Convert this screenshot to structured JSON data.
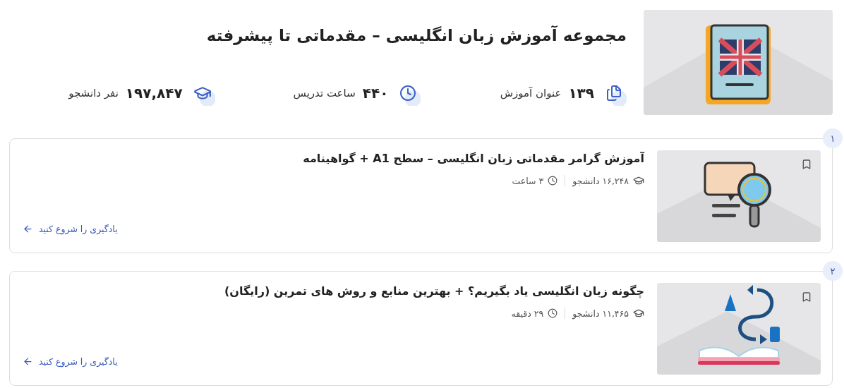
{
  "course": {
    "title": "مجموعه آموزش زبان انگلیسی – مقدماتی تا پیشرفته",
    "stats": [
      {
        "kind": "lessons",
        "value": "۱۳۹",
        "label": "عنوان آموزش"
      },
      {
        "kind": "hours",
        "value": "۴۴۰",
        "label": "ساعت تدریس"
      },
      {
        "kind": "students",
        "value": "۱۹۷,۸۴۷",
        "label": "نفر دانشجو"
      }
    ]
  },
  "lessons": [
    {
      "number": "۱",
      "title": "آموزش گرامر مقدماتی زبان انگلیسی – سطح A1 + گواهینامه",
      "students": "۱۶,۲۴۸ دانشجو",
      "duration": "۳ ساعت",
      "link": "یادگیری را شروع کنید"
    },
    {
      "number": "۲",
      "title": "چگونه زبان انگلیسی یاد بگیریم؟ + بهترین منابع و روش های تمرین (رایگان)",
      "students": "۱۱,۴۶۵ دانشجو",
      "duration": "۲۹ دقیقه",
      "link": "یادگیری را شروع کنید"
    }
  ]
}
